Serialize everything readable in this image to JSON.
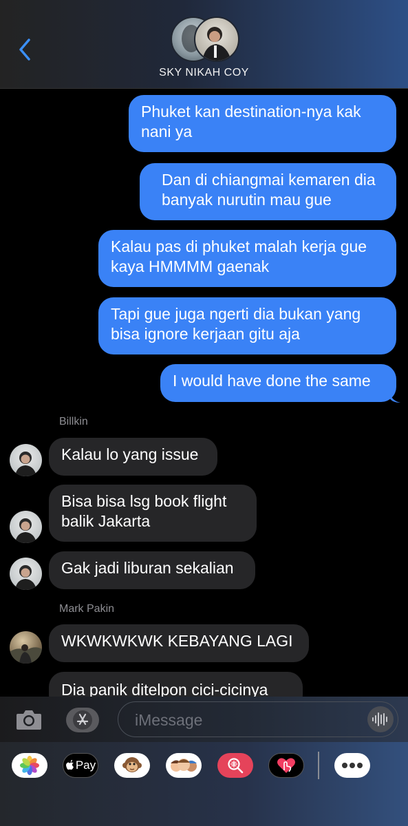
{
  "header": {
    "group_name": "SKY NIKAH COY",
    "back_icon": "chevron-left-icon",
    "accent": "#3b8ff5"
  },
  "messages": [
    {
      "dir": "out",
      "text": "Phuket kan destination-nya kak nani ya"
    },
    {
      "dir": "out",
      "text": "Dan di chiangmai kemaren dia banyak nurutin mau gue"
    },
    {
      "dir": "out",
      "text": "Kalau pas di phuket malah kerja gue kaya HMMMM gaenak"
    },
    {
      "dir": "out",
      "text": "Tapi gue juga ngerti dia bukan yang bisa ignore kerjaan gitu aja"
    },
    {
      "dir": "out",
      "text": "I would have done the same"
    },
    {
      "dir": "sender",
      "text": "Billkin"
    },
    {
      "dir": "in",
      "text": "Kalau lo yang issue"
    },
    {
      "dir": "in",
      "text": "Bisa bisa lsg book flight balik Jakarta"
    },
    {
      "dir": "in",
      "text": "Gak jadi liburan sekalian"
    },
    {
      "dir": "sender",
      "text": "Mark Pakin"
    },
    {
      "dir": "in",
      "text": "WKWKWKWK KEBAYANG LAGI"
    },
    {
      "dir": "in",
      "text": "Dia panik ditelpon cici-cicinya"
    }
  ],
  "input": {
    "placeholder": "iMessage",
    "camera_icon": "camera-icon",
    "appstore_icon": "app-store-icon",
    "audio_icon": "waveform-icon"
  },
  "tray": {
    "apps": [
      "photos-icon",
      "apple-pay-icon",
      "animoji-icon",
      "memoji-icon",
      "image-search-icon",
      "digital-touch-icon",
      "more-icon"
    ],
    "applepay_label": "Pay"
  },
  "colors": {
    "outgoing": "#3a82f6",
    "incoming": "#262628",
    "background": "#000000"
  }
}
